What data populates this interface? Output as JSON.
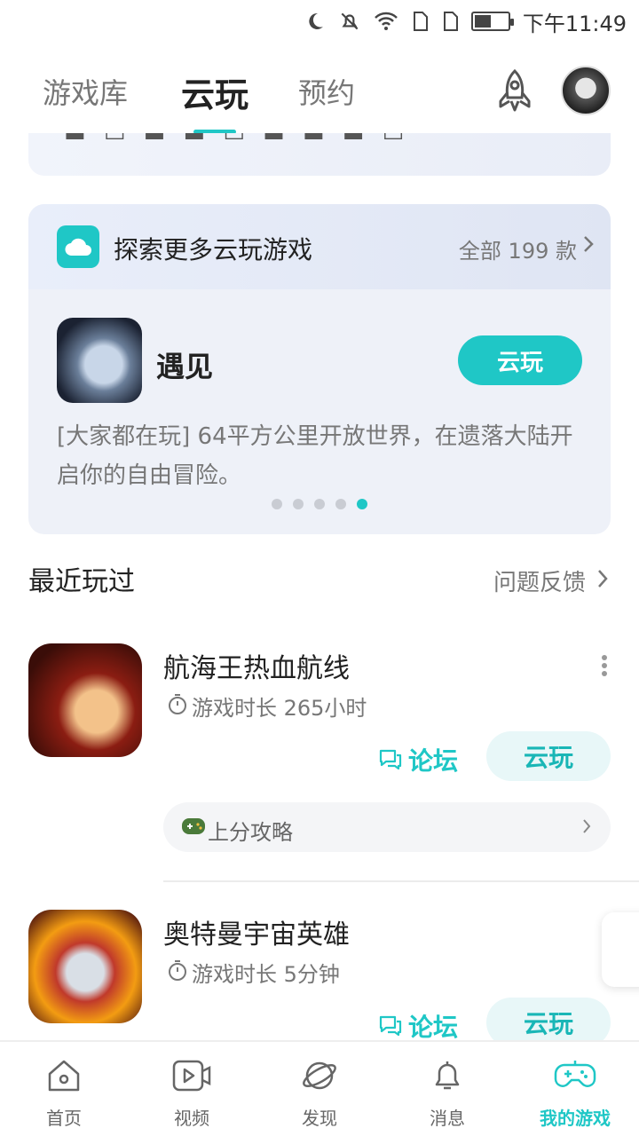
{
  "status_bar": {
    "time": "下午11:49"
  },
  "top_tabs": [
    {
      "label": "游戏库",
      "active": false
    },
    {
      "label": "云玩",
      "active": true
    },
    {
      "label": "预约",
      "active": false
    }
  ],
  "colors": {
    "accent": "#1fc7c6"
  },
  "explore": {
    "title": "探索更多云玩游戏",
    "all_label": "全部 199 款",
    "game": {
      "name": "遇见",
      "button": "云玩",
      "description": "[大家都在玩] 64平方公里开放世界，在遗落大陆开启你的自由冒险。"
    },
    "carousel": {
      "count": 5,
      "active_index": 4
    }
  },
  "recent": {
    "title": "最近玩过",
    "feedback": "问题反馈",
    "games": [
      {
        "name": "航海王热血航线",
        "playtime": "游戏时长 265小时",
        "forum_label": "论坛",
        "play_label": "云玩",
        "guide_label": "上分攻略"
      },
      {
        "name": "奥特曼宇宙英雄",
        "playtime": "游戏时长 5分钟",
        "forum_label": "论坛",
        "play_label": "云玩"
      }
    ]
  },
  "bottom_nav": [
    {
      "label": "首页",
      "icon": "home-icon",
      "active": false
    },
    {
      "label": "视频",
      "icon": "video-icon",
      "active": false
    },
    {
      "label": "发现",
      "icon": "planet-icon",
      "active": false
    },
    {
      "label": "消息",
      "icon": "bell-icon",
      "active": false
    },
    {
      "label": "我的游戏",
      "icon": "gamepad-icon",
      "active": true
    }
  ]
}
